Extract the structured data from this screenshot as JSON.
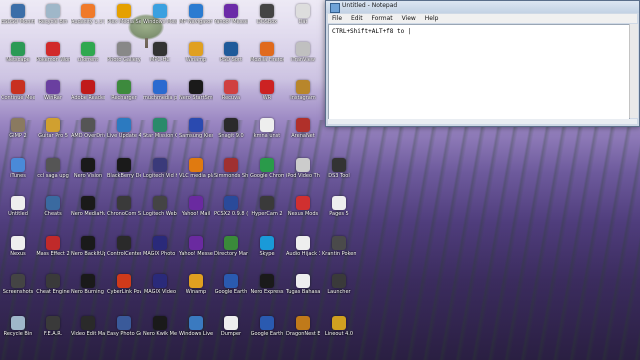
{
  "notepad": {
    "title": "Untitled - Notepad",
    "menu": [
      "File",
      "Edit",
      "Format",
      "View",
      "Help"
    ],
    "text": "CTRL+Shift+ALT+f8 to |"
  },
  "desktop_icons": [
    {
      "label": "ESDSO Monitors",
      "color": "#3c6ea8"
    },
    {
      "label": "Recycle Bin",
      "color": "#9fb7c9"
    },
    {
      "label": "Audacity 1.3 Beta (Unic...",
      "color": "#f07a2a"
    },
    {
      "label": "Plex Media Server",
      "color": "#e5a000"
    },
    {
      "label": "Windows Messenger",
      "color": "#3aa0e0"
    },
    {
      "label": "MP Navigator EX",
      "color": "#2b7bd1"
    },
    {
      "label": "Yahoo! Messenger",
      "color": "#6b2aa8"
    },
    {
      "label": "DOSBox",
      "color": "#444"
    },
    {
      "label": "Dat",
      "color": "#ddd"
    },
    {
      "label": "Netscape",
      "color": "#2b9a55"
    },
    {
      "label": "Pokemon World Online",
      "color": "#d12a2a"
    },
    {
      "label": "uTorrent",
      "color": "#2fa84f"
    },
    {
      "label": "Photo Gallery",
      "color": "#888"
    },
    {
      "label": "MPC-HC",
      "color": "#333"
    },
    {
      "label": "Winamp",
      "color": "#e0a020"
    },
    {
      "label": "PSD Sort",
      "color": "#1f5a9a"
    },
    {
      "label": "Mozilla Firefox",
      "color": "#e06a1c"
    },
    {
      "label": "iTranView",
      "color": "#c0c0c0"
    },
    {
      "label": "Continue Meets...",
      "color": "#c83020"
    },
    {
      "label": "WinRar",
      "color": "#6a3fa0"
    },
    {
      "label": "Adobe Reader 9",
      "color": "#c01a1a"
    },
    {
      "label": "Recharger",
      "color": "#3d8a3d"
    },
    {
      "label": "muchmedia player",
      "color": "#2a6ad0"
    },
    {
      "label": "Nero StartSmart 10",
      "color": "#1a1a1a"
    },
    {
      "label": "Recuva",
      "color": "#d04040"
    },
    {
      "label": "WR",
      "color": "#c22"
    },
    {
      "label": "Instagram",
      "color": "#b8862b"
    },
    {
      "label": "GIMP 2",
      "color": "#8a7a60"
    },
    {
      "label": "Guitar Pro 5",
      "color": "#d0a030"
    },
    {
      "label": "AMD OverDrive",
      "color": "#555"
    },
    {
      "label": "Live Update 4",
      "color": "#2c7ac0"
    },
    {
      "label": "Star Mission Online",
      "color": "#2a8a6a"
    },
    {
      "label": "Samsung Kies",
      "color": "#2a4ab0"
    },
    {
      "label": "Snagit 9.0",
      "color": "#2a2a2a"
    },
    {
      "label": "kmna unst",
      "color": "#eee"
    },
    {
      "label": "ArenaNet",
      "color": "#b0302a"
    },
    {
      "label": "iTunes",
      "color": "#4a8ad8"
    },
    {
      "label": "ccl saga upg",
      "color": "#555"
    },
    {
      "label": "Nero Vision",
      "color": "#1a1a1a"
    },
    {
      "label": "BlackBerry Desktop",
      "color": "#1a1a1a"
    },
    {
      "label": "Logitech Vid HD",
      "color": "#3a3a7a"
    },
    {
      "label": "VLC media player",
      "color": "#e07a10"
    },
    {
      "label": "Simmonds ShotBeat",
      "color": "#a03030"
    },
    {
      "label": "Google Chrome",
      "color": "#2a9a4a"
    },
    {
      "label": "iPod Video Thumbnails",
      "color": "#ccc"
    },
    {
      "label": "DS3 Tool",
      "color": "#333"
    },
    {
      "label": "Untitled",
      "color": "#eee"
    },
    {
      "label": "Cheats",
      "color": "#3a6aa0"
    },
    {
      "label": "Nero MediaHub 10",
      "color": "#1a1a1a"
    },
    {
      "label": "ChronoCom Snake Game",
      "color": "#3a3a3a"
    },
    {
      "label": "Logitech Webcam",
      "color": "#444"
    },
    {
      "label": "Yahoo! Mail",
      "color": "#6a2aa0"
    },
    {
      "label": "PCSX2 0.9.8 (r4600)",
      "color": "#2a4a9a"
    },
    {
      "label": "HyperCam 2",
      "color": "#3a3a3a"
    },
    {
      "label": "Nexus Mods",
      "color": "#d03030"
    },
    {
      "label": "Pages 5",
      "color": "#eee"
    },
    {
      "label": "Nexus",
      "color": "#eee"
    },
    {
      "label": "Mass Effect 2",
      "color": "#c02a2a"
    },
    {
      "label": "Nero BackItUp 10",
      "color": "#1a1a1a"
    },
    {
      "label": "ControlCenter",
      "color": "#2a2a2a"
    },
    {
      "label": "MAGIX Photo M...",
      "color": "#2a2a7a"
    },
    {
      "label": "Yahoo! Messenger",
      "color": "#6a2aa0"
    },
    {
      "label": "Directory Manager",
      "color": "#3a8a3a"
    },
    {
      "label": "Skype",
      "color": "#1a9ad8"
    },
    {
      "label": "Audio Hijack 3",
      "color": "#eee"
    },
    {
      "label": "Krantin Pokemon",
      "color": "#4a4a4a"
    },
    {
      "label": "Screenshots",
      "color": "#444"
    },
    {
      "label": "Cheat Engine",
      "color": "#3a3a3a"
    },
    {
      "label": "Nero Burning ROM 10",
      "color": "#1a1a1a"
    },
    {
      "label": "CyberLink PowerDVD",
      "color": "#d03a1a"
    },
    {
      "label": "MAGIX Video",
      "color": "#2a2a7a"
    },
    {
      "label": "Winamp",
      "color": "#e0a020"
    },
    {
      "label": "Google Earth",
      "color": "#2a5ab0"
    },
    {
      "label": "Nero Express",
      "color": "#1a1a1a"
    },
    {
      "label": "Tugas Bahasa Inggris",
      "color": "#eee"
    },
    {
      "label": "Launcher",
      "color": "#3a3a3a"
    },
    {
      "label": "Recycle Bin",
      "color": "#9fb7c9"
    },
    {
      "label": "F.E.A.R.",
      "color": "#3a3a3a"
    },
    {
      "label": "Video Edit Master",
      "color": "#2a2a2a"
    },
    {
      "label": "Easy Photo Grab",
      "color": "#3a5a9a"
    },
    {
      "label": "Nero Kwik Media",
      "color": "#1a1a1a"
    },
    {
      "label": "Windows Live",
      "color": "#3a7ac0"
    },
    {
      "label": "Dumper",
      "color": "#eee"
    },
    {
      "label": "Google Earth",
      "color": "#2a5ab0"
    },
    {
      "label": "DragonNest Ent",
      "color": "#c07a1a"
    },
    {
      "label": "Lineout 4.0",
      "color": "#d0a020"
    }
  ]
}
